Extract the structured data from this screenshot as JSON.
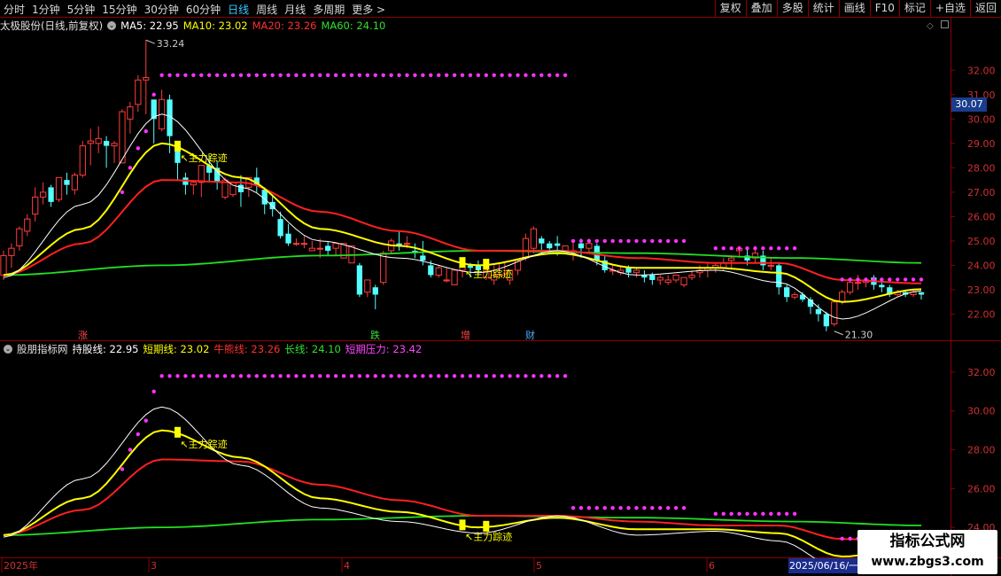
{
  "toolbar": {
    "periods": [
      "分时",
      "1分钟",
      "5分钟",
      "15分钟",
      "30分钟",
      "60分钟",
      "日线",
      "周线",
      "月线",
      "多周期",
      "更多 >"
    ],
    "active_index": 6,
    "tools": [
      "复权",
      "叠加",
      "多股",
      "统计",
      "画线",
      "F10",
      "标记",
      "+自选",
      "返回"
    ]
  },
  "upper": {
    "stock": "太极股份(日线,前复权)",
    "ma5": "MA5: 22.95",
    "ma10": "MA10: 23.02",
    "ma20": "MA20: 23.26",
    "ma60": "MA60: 24.10",
    "high_label": "33.24",
    "low_label": "21.30",
    "current_price": "30.07",
    "signal": "主力踪迹",
    "markers": [
      {
        "text": "涨",
        "color": "#ff4444",
        "x": 88
      },
      {
        "text": "跌",
        "color": "#33dd33",
        "x": 418
      },
      {
        "text": "增",
        "color": "#ff4444",
        "x": 520
      },
      {
        "text": "财",
        "color": "#44aaff",
        "x": 593
      }
    ],
    "y_ticks": [
      "32.00",
      "31.00",
      "30.00",
      "29.00",
      "28.00",
      "27.00",
      "26.00",
      "25.00",
      "24.00",
      "23.00",
      "22.00"
    ]
  },
  "lower": {
    "name": "股朋指标网",
    "hold": "持股线: 22.95",
    "short": "短期线: 23.02",
    "bull": "牛熊线: 23.26",
    "long": "长线: 24.10",
    "pressure": "短期压力: 23.42",
    "y_ticks": [
      "32.00",
      "30.00",
      "28.00",
      "26.00",
      "24.00"
    ]
  },
  "xaxis": {
    "labels": [
      "2025年",
      "3",
      "4",
      "5",
      "6"
    ],
    "cursor_date": "2025/06/16/一"
  },
  "watermark": {
    "line1": "指标公式网",
    "line2": "www.zbgs3.com"
  },
  "colors": {
    "up": "#ff3c3c",
    "down": "#54ffff",
    "ma5": "#ffffff",
    "ma10": "#ffff00",
    "ma20": "#ff2020",
    "ma60": "#20e020",
    "dots": "#ff33ff",
    "signal": "#ffff00"
  },
  "chart_data": {
    "type": "candlestick",
    "y_range_upper": [
      21.0,
      33.5
    ],
    "y_range_lower": [
      22.5,
      33.0
    ],
    "candles": [
      [
        23.6,
        24.6,
        24.4,
        23.4
      ],
      [
        24.4,
        24.9,
        24.7,
        23.9
      ],
      [
        24.8,
        25.6,
        25.5,
        24.6
      ],
      [
        25.4,
        26.1,
        25.9,
        25.2
      ],
      [
        26.1,
        27.2,
        26.8,
        25.8
      ],
      [
        26.8,
        27.4,
        27.0,
        26.5
      ],
      [
        27.2,
        27.3,
        26.6,
        26.4
      ],
      [
        26.7,
        27.6,
        27.6,
        26.6
      ],
      [
        27.5,
        27.8,
        27.3,
        26.9
      ],
      [
        27.1,
        27.8,
        27.7,
        26.9
      ],
      [
        27.7,
        29.1,
        28.9,
        27.6
      ],
      [
        29.0,
        29.6,
        29.1,
        28.1
      ],
      [
        29.0,
        29.7,
        29.2,
        28.6
      ],
      [
        29.1,
        29.3,
        28.9,
        28.0
      ],
      [
        28.9,
        29.1,
        29.0,
        28.2
      ],
      [
        28.2,
        30.4,
        30.3,
        28.2
      ],
      [
        30.0,
        30.7,
        30.5,
        29.4
      ],
      [
        30.6,
        31.8,
        31.6,
        30.3
      ],
      [
        31.6,
        33.24,
        31.7,
        30.2
      ],
      [
        30.8,
        30.6,
        30.0,
        29.0
      ],
      [
        29.6,
        31.2,
        30.8,
        29.5
      ],
      [
        30.8,
        31.0,
        29.3,
        28.6
      ],
      [
        28.9,
        29.1,
        28.2,
        27.5
      ],
      [
        27.6,
        27.8,
        27.3,
        26.9
      ],
      [
        27.3,
        27.5,
        27.4,
        26.9
      ],
      [
        27.4,
        28.1,
        28.1,
        26.8
      ],
      [
        28.1,
        28.5,
        27.8,
        27.4
      ],
      [
        28.0,
        28.3,
        27.4,
        27.1
      ],
      [
        26.8,
        27.6,
        27.5,
        26.7
      ],
      [
        26.9,
        27.3,
        27.4,
        26.8
      ],
      [
        27.3,
        27.7,
        27.0,
        26.4
      ],
      [
        27.2,
        27.5,
        27.6,
        26.8
      ],
      [
        27.6,
        28.0,
        27.3,
        27.0
      ],
      [
        27.1,
        27.2,
        26.5,
        26.1
      ],
      [
        26.6,
        26.9,
        26.3,
        26.0
      ],
      [
        25.9,
        26.2,
        25.2,
        25.1
      ],
      [
        25.3,
        25.7,
        24.9,
        24.8
      ],
      [
        24.9,
        25.1,
        24.9,
        24.8
      ],
      [
        24.9,
        25.2,
        24.9,
        24.7
      ],
      [
        24.6,
        25.0,
        24.7,
        24.6
      ],
      [
        24.7,
        25.1,
        24.7,
        24.3
      ],
      [
        24.8,
        25.0,
        24.6,
        24.4
      ],
      [
        24.7,
        24.9,
        24.9,
        24.4
      ],
      [
        24.3,
        24.8,
        24.9,
        24.4
      ],
      [
        24.1,
        24.4,
        24.8,
        24.1
      ],
      [
        24.0,
        24.1,
        22.8,
        22.7
      ],
      [
        22.9,
        23.4,
        23.4,
        22.7
      ],
      [
        23.1,
        23.2,
        22.8,
        22.2
      ],
      [
        23.3,
        24.6,
        24.5,
        23.2
      ],
      [
        24.6,
        25.1,
        25.0,
        24.5
      ],
      [
        24.9,
        25.4,
        24.8,
        24.6
      ],
      [
        24.9,
        25.2,
        24.9,
        24.7
      ],
      [
        24.6,
        24.9,
        24.5,
        24.3
      ],
      [
        24.4,
        25.0,
        24.2,
        24.0
      ],
      [
        24.0,
        24.2,
        23.6,
        23.5
      ],
      [
        23.6,
        24.0,
        23.9,
        23.5
      ],
      [
        23.4,
        23.9,
        23.4,
        23.3
      ],
      [
        23.2,
        23.6,
        23.8,
        23.3
      ],
      [
        23.8,
        24.2,
        24.0,
        23.5
      ],
      [
        24.0,
        24.1,
        23.9,
        23.5
      ],
      [
        24.0,
        24.2,
        23.8,
        23.6
      ],
      [
        23.5,
        24.0,
        23.8,
        23.4
      ],
      [
        23.4,
        24.0,
        23.6,
        23.2
      ],
      [
        23.6,
        23.9,
        24.1,
        23.5
      ],
      [
        23.4,
        23.6,
        23.8,
        23.2
      ],
      [
        23.8,
        24.0,
        24.2,
        23.6
      ],
      [
        24.3,
        25.3,
        25.1,
        24.2
      ],
      [
        24.7,
        25.6,
        25.5,
        24.5
      ],
      [
        25.1,
        25.2,
        24.9,
        24.5
      ],
      [
        24.9,
        25.0,
        24.7,
        24.5
      ],
      [
        24.9,
        25.2,
        24.8,
        24.4
      ],
      [
        24.6,
        24.8,
        24.8,
        24.5
      ],
      [
        24.6,
        25.0,
        24.6,
        24.2
      ],
      [
        24.9,
        25.1,
        24.7,
        24.3
      ],
      [
        24.7,
        25.1,
        24.9,
        24.5
      ],
      [
        24.8,
        24.9,
        24.2,
        24.0
      ],
      [
        24.2,
        24.4,
        23.8,
        23.7
      ],
      [
        23.8,
        24.0,
        23.8,
        23.6
      ],
      [
        23.7,
        24.0,
        23.8,
        23.6
      ],
      [
        23.9,
        24.0,
        23.7,
        23.5
      ],
      [
        23.7,
        23.9,
        23.8,
        23.5
      ],
      [
        23.6,
        23.8,
        23.5,
        23.3
      ],
      [
        23.6,
        23.7,
        23.4,
        23.2
      ],
      [
        23.4,
        23.6,
        23.5,
        23.2
      ],
      [
        23.3,
        23.6,
        23.4,
        23.2
      ],
      [
        23.4,
        23.6,
        23.6,
        23.3
      ],
      [
        23.2,
        23.4,
        23.5,
        23.1
      ],
      [
        23.5,
        23.8,
        23.6,
        23.4
      ],
      [
        23.7,
        24.0,
        23.8,
        23.5
      ],
      [
        23.8,
        24.1,
        23.9,
        23.5
      ],
      [
        23.9,
        24.1,
        24.0,
        23.7
      ],
      [
        23.9,
        24.3,
        24.1,
        23.8
      ],
      [
        24.2,
        24.4,
        24.3,
        23.9
      ],
      [
        24.6,
        24.8,
        24.7,
        24.3
      ],
      [
        24.4,
        24.7,
        24.2,
        24.0
      ],
      [
        24.3,
        24.8,
        24.5,
        24.1
      ],
      [
        24.4,
        24.6,
        24.0,
        23.8
      ],
      [
        24.0,
        24.3,
        24.0,
        23.8
      ],
      [
        24.0,
        24.1,
        23.1,
        22.8
      ],
      [
        23.1,
        23.2,
        22.7,
        22.5
      ],
      [
        22.7,
        22.9,
        22.8,
        22.6
      ],
      [
        22.8,
        22.9,
        22.6,
        22.5
      ],
      [
        22.6,
        22.7,
        22.3,
        22.0
      ],
      [
        22.2,
        22.4,
        22.0,
        21.7
      ],
      [
        22.0,
        22.1,
        21.5,
        21.3
      ],
      [
        21.6,
        22.6,
        22.5,
        21.5
      ],
      [
        22.5,
        23.0,
        22.9,
        22.4
      ],
      [
        22.9,
        23.4,
        23.3,
        22.8
      ],
      [
        23.3,
        23.6,
        23.3,
        23.0
      ],
      [
        23.3,
        23.5,
        23.4,
        23.1
      ],
      [
        23.5,
        23.6,
        23.2,
        23.0
      ],
      [
        23.2,
        23.4,
        23.1,
        22.9
      ],
      [
        23.1,
        23.2,
        22.8,
        22.7
      ],
      [
        22.8,
        23.0,
        22.9,
        22.7
      ],
      [
        22.9,
        23.0,
        22.8,
        22.7
      ],
      [
        22.8,
        23.0,
        22.9,
        22.7
      ],
      [
        22.9,
        22.9,
        22.8,
        22.6
      ]
    ],
    "ma_lines": {
      "ma5": [
        [
          0,
          23.5
        ],
        [
          10,
          26.5
        ],
        [
          20,
          30.2
        ],
        [
          30,
          27.2
        ],
        [
          40,
          25.0
        ],
        [
          50,
          24.3
        ],
        [
          60,
          23.7
        ],
        [
          70,
          24.6
        ],
        [
          80,
          23.6
        ],
        [
          90,
          23.8
        ],
        [
          98,
          23.3
        ],
        [
          106,
          21.8
        ],
        [
          116,
          22.95
        ]
      ],
      "ma10": [
        [
          0,
          23.6
        ],
        [
          10,
          25.5
        ],
        [
          20,
          29.0
        ],
        [
          30,
          27.6
        ],
        [
          40,
          25.5
        ],
        [
          50,
          24.8
        ],
        [
          60,
          24.0
        ],
        [
          70,
          24.5
        ],
        [
          80,
          23.9
        ],
        [
          90,
          23.9
        ],
        [
          98,
          23.7
        ],
        [
          106,
          22.5
        ],
        [
          116,
          23.02
        ]
      ],
      "ma20": [
        [
          0,
          23.6
        ],
        [
          10,
          24.9
        ],
        [
          20,
          27.5
        ],
        [
          30,
          27.4
        ],
        [
          40,
          26.2
        ],
        [
          50,
          25.4
        ],
        [
          60,
          24.6
        ],
        [
          70,
          24.6
        ],
        [
          80,
          24.3
        ],
        [
          90,
          24.1
        ],
        [
          98,
          24.1
        ],
        [
          106,
          23.4
        ],
        [
          116,
          23.26
        ]
      ],
      "ma60": [
        [
          0,
          23.6
        ],
        [
          20,
          24.0
        ],
        [
          40,
          24.4
        ],
        [
          60,
          24.6
        ],
        [
          80,
          24.5
        ],
        [
          100,
          24.3
        ],
        [
          116,
          24.1
        ]
      ]
    },
    "pressure_dots": [
      {
        "from": 15,
        "to": 20,
        "values": [
          27.0,
          28.0,
          28.8,
          29.5,
          31.0,
          31.8
        ]
      },
      {
        "from": 21,
        "to": 71,
        "value": 31.8
      },
      {
        "from": 72,
        "to": 86,
        "value": 25.0
      },
      {
        "from": 90,
        "to": 100,
        "value": 24.7
      },
      {
        "from": 106,
        "to": 116,
        "value": 23.42
      }
    ],
    "signals": [
      22,
      58,
      61
    ]
  }
}
